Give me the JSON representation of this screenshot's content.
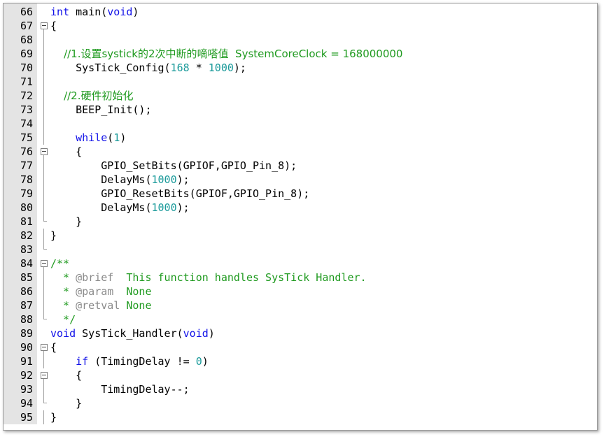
{
  "editor": {
    "lines": [
      {
        "n": "66",
        "fold": "none",
        "tokens": [
          {
            "t": "kw",
            "v": "int"
          },
          {
            "t": "p",
            "v": " main("
          },
          {
            "t": "kw",
            "v": "void"
          },
          {
            "t": "p",
            "v": ")"
          }
        ]
      },
      {
        "n": "67",
        "fold": "open",
        "tokens": [
          {
            "t": "p",
            "v": "{"
          }
        ]
      },
      {
        "n": "68",
        "fold": "line",
        "tokens": []
      },
      {
        "n": "69",
        "fold": "line",
        "tokens": [
          {
            "t": "cm",
            "v": "    //1.设置systick的2次中断的嘀嗒值  SystemCoreClock = 168000000"
          }
        ]
      },
      {
        "n": "70",
        "fold": "line",
        "tokens": [
          {
            "t": "p",
            "v": "    SysTick_Config("
          },
          {
            "t": "num",
            "v": "168"
          },
          {
            "t": "p",
            "v": " * "
          },
          {
            "t": "num",
            "v": "1000"
          },
          {
            "t": "p",
            "v": ");"
          }
        ]
      },
      {
        "n": "71",
        "fold": "line",
        "tokens": []
      },
      {
        "n": "72",
        "fold": "line",
        "tokens": [
          {
            "t": "cm",
            "v": "    //2.硬件初始化"
          }
        ]
      },
      {
        "n": "73",
        "fold": "line",
        "tokens": [
          {
            "t": "p",
            "v": "    BEEP_Init();"
          }
        ]
      },
      {
        "n": "74",
        "fold": "line",
        "tokens": []
      },
      {
        "n": "75",
        "fold": "line",
        "tokens": [
          {
            "t": "kw",
            "v": "    while"
          },
          {
            "t": "p",
            "v": "("
          },
          {
            "t": "num",
            "v": "1"
          },
          {
            "t": "p",
            "v": ")"
          }
        ]
      },
      {
        "n": "76",
        "fold": "open",
        "tokens": [
          {
            "t": "p",
            "v": "    {"
          }
        ]
      },
      {
        "n": "77",
        "fold": "line",
        "tokens": [
          {
            "t": "p",
            "v": "        GPIO_SetBits(GPIOF,GPIO_Pin_8);"
          }
        ]
      },
      {
        "n": "78",
        "fold": "line",
        "tokens": [
          {
            "t": "p",
            "v": "        DelayMs("
          },
          {
            "t": "num",
            "v": "1000"
          },
          {
            "t": "p",
            "v": ");"
          }
        ]
      },
      {
        "n": "79",
        "fold": "line",
        "tokens": [
          {
            "t": "p",
            "v": "        GPIO_ResetBits(GPIOF,GPIO_Pin_8);"
          }
        ]
      },
      {
        "n": "80",
        "fold": "line",
        "tokens": [
          {
            "t": "p",
            "v": "        DelayMs("
          },
          {
            "t": "num",
            "v": "1000"
          },
          {
            "t": "p",
            "v": ");"
          }
        ]
      },
      {
        "n": "81",
        "fold": "end",
        "tokens": [
          {
            "t": "p",
            "v": "    }"
          }
        ]
      },
      {
        "n": "82",
        "fold": "line",
        "tokens": [
          {
            "t": "p",
            "v": "}"
          }
        ]
      },
      {
        "n": "83",
        "fold": "end",
        "tokens": []
      },
      {
        "n": "84",
        "fold": "open",
        "tokens": [
          {
            "t": "cm",
            "v": "/**"
          }
        ]
      },
      {
        "n": "85",
        "fold": "line",
        "tokens": [
          {
            "t": "cm",
            "v": "  * "
          },
          {
            "t": "tag",
            "v": "@brief"
          },
          {
            "t": "cm",
            "v": "  This function handles SysTick Handler."
          }
        ]
      },
      {
        "n": "86",
        "fold": "line",
        "tokens": [
          {
            "t": "cm",
            "v": "  * "
          },
          {
            "t": "tag",
            "v": "@param"
          },
          {
            "t": "cm",
            "v": "  None"
          }
        ]
      },
      {
        "n": "87",
        "fold": "line",
        "tokens": [
          {
            "t": "cm",
            "v": "  * "
          },
          {
            "t": "tag",
            "v": "@retval"
          },
          {
            "t": "cm",
            "v": " None"
          }
        ]
      },
      {
        "n": "88",
        "fold": "end",
        "tokens": [
          {
            "t": "cm",
            "v": "  */"
          }
        ]
      },
      {
        "n": "89",
        "fold": "none",
        "tokens": [
          {
            "t": "kw",
            "v": "void"
          },
          {
            "t": "p",
            "v": " SysTick_Handler("
          },
          {
            "t": "kw",
            "v": "void"
          },
          {
            "t": "p",
            "v": ")"
          }
        ]
      },
      {
        "n": "90",
        "fold": "open",
        "tokens": [
          {
            "t": "p",
            "v": "{"
          }
        ]
      },
      {
        "n": "91",
        "fold": "line",
        "tokens": [
          {
            "t": "kw",
            "v": "    if"
          },
          {
            "t": "p",
            "v": " (TimingDelay != "
          },
          {
            "t": "num",
            "v": "0"
          },
          {
            "t": "p",
            "v": ")"
          }
        ]
      },
      {
        "n": "92",
        "fold": "open",
        "tokens": [
          {
            "t": "p",
            "v": "    {"
          }
        ]
      },
      {
        "n": "93",
        "fold": "line",
        "tokens": [
          {
            "t": "p",
            "v": "        TimingDelay--;"
          }
        ]
      },
      {
        "n": "94",
        "fold": "end",
        "tokens": [
          {
            "t": "p",
            "v": "    }"
          }
        ]
      },
      {
        "n": "95",
        "fold": "line",
        "tokens": [
          {
            "t": "p",
            "v": "}"
          }
        ]
      }
    ]
  }
}
